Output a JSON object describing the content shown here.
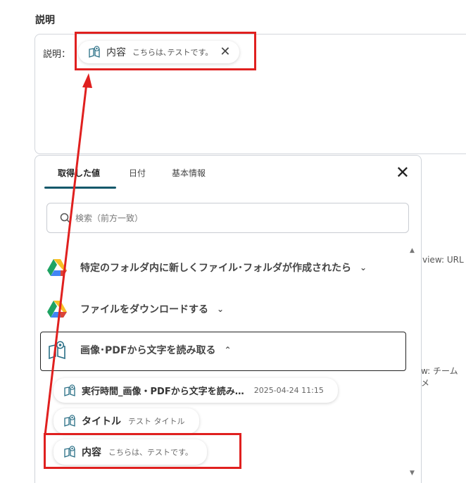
{
  "section": {
    "label": "説明"
  },
  "description_field": {
    "prefix": "説明：",
    "chip": {
      "name": "内容",
      "value": "こちらは､テストです。"
    }
  },
  "background_text": {
    "view_url": "view: URL",
    "team": "w: チームメ"
  },
  "panel": {
    "tabs": [
      {
        "label": "取得した値",
        "active": true
      },
      {
        "label": "日付",
        "active": false
      },
      {
        "label": "基本情報",
        "active": false
      }
    ],
    "search": {
      "placeholder": "検索（前方一致）"
    },
    "groups": [
      {
        "label": "特定のフォルダ内に新しくファイル･フォルダが作成されたら",
        "icon": "google-drive-icon",
        "expanded": false
      },
      {
        "label": "ファイルをダウンロードする",
        "icon": "google-drive-icon",
        "expanded": false
      },
      {
        "label": "画像･PDFから文字を読み取る",
        "icon": "ocr-book-icon",
        "expanded": true
      }
    ],
    "values": [
      {
        "name": "実行時間_画像・PDFから文字を読み…",
        "value": "2025-04-24 11:15"
      },
      {
        "name": "タイトル",
        "value": "テスト タイトル"
      },
      {
        "name": "内容",
        "value": "こちらは、テストです。"
      }
    ]
  },
  "colors": {
    "annotation": "#e0201f",
    "tab_underline": "#13586a"
  }
}
